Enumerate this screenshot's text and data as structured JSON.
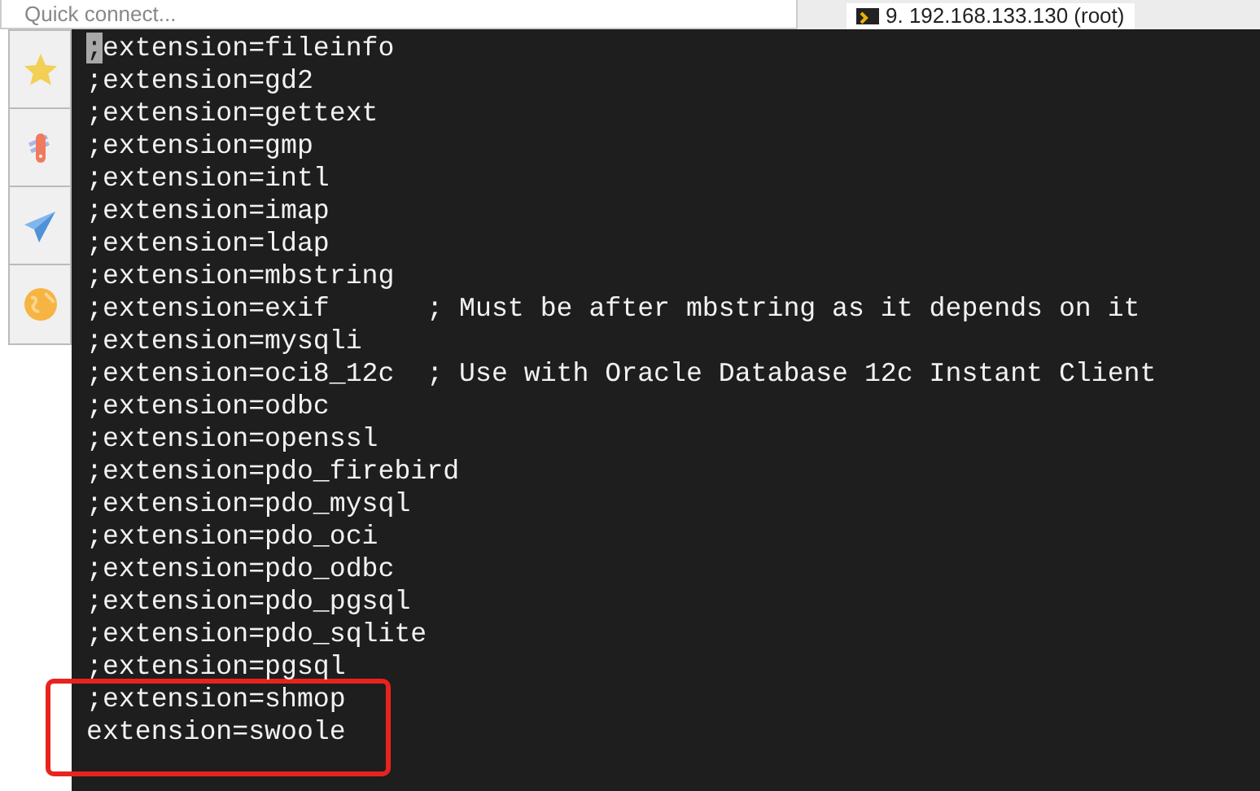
{
  "toolbar": {
    "quick_connect": {
      "placeholder": "Quick connect..."
    },
    "session_tab": {
      "label": "9. 192.168.133.130 (root)",
      "selected": true
    }
  },
  "sidebar": {
    "items": [
      {
        "kind": "star"
      },
      {
        "kind": "knife"
      },
      {
        "kind": "plane"
      },
      {
        "kind": "globe"
      }
    ]
  },
  "terminal": {
    "lines": [
      {
        "text": ";extension=fileinfo",
        "cursor": true,
        "highlighted": false
      },
      {
        "text": ";extension=gd2",
        "cursor": false,
        "highlighted": false
      },
      {
        "text": ";extension=gettext",
        "cursor": false,
        "highlighted": false
      },
      {
        "text": ";extension=gmp",
        "cursor": false,
        "highlighted": false
      },
      {
        "text": ";extension=intl",
        "cursor": false,
        "highlighted": false
      },
      {
        "text": ";extension=imap",
        "cursor": false,
        "highlighted": false
      },
      {
        "text": ";extension=ldap",
        "cursor": false,
        "highlighted": false
      },
      {
        "text": ";extension=mbstring",
        "cursor": false,
        "highlighted": false
      },
      {
        "text": ";extension=exif      ; Must be after mbstring as it depends on it",
        "cursor": false,
        "highlighted": false
      },
      {
        "text": ";extension=mysqli",
        "cursor": false,
        "highlighted": false
      },
      {
        "text": ";extension=oci8_12c  ; Use with Oracle Database 12c Instant Client",
        "cursor": false,
        "highlighted": false
      },
      {
        "text": ";extension=odbc",
        "cursor": false,
        "highlighted": false
      },
      {
        "text": ";extension=openssl",
        "cursor": false,
        "highlighted": false
      },
      {
        "text": ";extension=pdo_firebird",
        "cursor": false,
        "highlighted": false
      },
      {
        "text": ";extension=pdo_mysql",
        "cursor": false,
        "highlighted": false
      },
      {
        "text": ";extension=pdo_oci",
        "cursor": false,
        "highlighted": false
      },
      {
        "text": ";extension=pdo_odbc",
        "cursor": false,
        "highlighted": false
      },
      {
        "text": ";extension=pdo_pgsql",
        "cursor": false,
        "highlighted": false
      },
      {
        "text": ";extension=pdo_sqlite",
        "cursor": false,
        "highlighted": false
      },
      {
        "text": ";extension=pgsql",
        "cursor": false,
        "highlighted": false
      },
      {
        "text": ";extension=shmop",
        "cursor": false,
        "highlighted": true
      },
      {
        "text": "extension=swoole",
        "cursor": false,
        "highlighted": true
      }
    ]
  }
}
